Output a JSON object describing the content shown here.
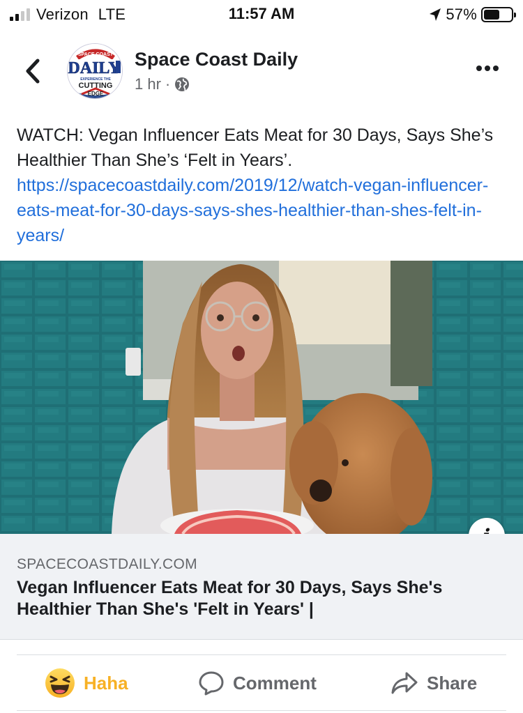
{
  "status_bar": {
    "carrier": "Verizon",
    "network": "LTE",
    "time": "11:57 AM",
    "battery_percent": "57%",
    "battery_level": 0.57,
    "signal_bars": 2
  },
  "post": {
    "page_name": "Space Coast Daily",
    "time_ago": "1 hr",
    "separator": "·",
    "privacy_icon": "globe-icon",
    "text": "WATCH: Vegan Influencer Eats Meat for 30 Days, Says She’s Healthier Than She’s ‘Felt in Years’.",
    "link": "https://spacecoastdaily.com/2019/12/watch-vegan-influencer-eats-meat-for-30-days-says-shes-healthier-than-shes-felt-in-years/",
    "avatar": {
      "top_text": "SPACE COAST",
      "main_text": "DAILY",
      "side_text": ".com",
      "tagline": "EXPERIENCE THE",
      "bottom_text": "CUTTING EDGE"
    }
  },
  "link_preview": {
    "domain": "SPACECOASTDAILY.COM",
    "title": "Vegan Influencer Eats Meat for 30 Days, Says She's Healthier Than She's 'Felt in Years' |",
    "info_label": "i"
  },
  "actions": {
    "reaction_label": "Haha",
    "reaction_icon": "haha-emoji-icon",
    "comment_label": "Comment",
    "comment_icon": "comment-bubble-icon",
    "share_label": "Share",
    "share_icon": "share-arrow-icon"
  },
  "colors": {
    "link": "#216fdb",
    "haha": "#f7b125",
    "muted": "#65676b",
    "preview_bg": "#f0f2f5"
  }
}
